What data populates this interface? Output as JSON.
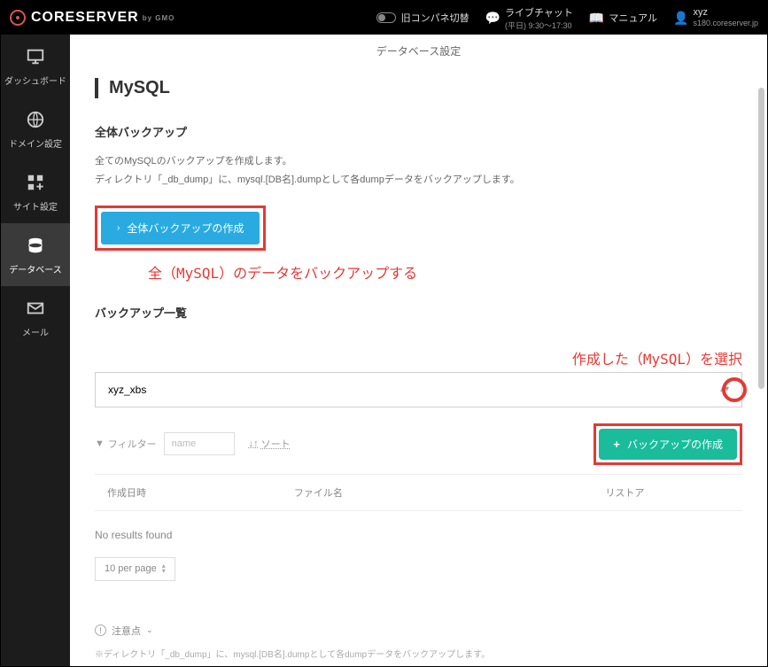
{
  "topbar": {
    "logo": "CORESERVER",
    "logo_sub": "by GMO",
    "old_panel": "旧コンパネ切替",
    "chat_label": "ライブチャット",
    "chat_hours": "(平日) 9:30～17:30",
    "manual": "マニュアル",
    "user": "xyz",
    "server": "s180.coreserver.jp"
  },
  "sidebar": {
    "items": [
      {
        "label": "ダッシュボード"
      },
      {
        "label": "ドメイン設定"
      },
      {
        "label": "サイト設定"
      },
      {
        "label": "データベース"
      },
      {
        "label": "メール"
      }
    ]
  },
  "crumb": "データベース設定",
  "page_title": "MySQL",
  "full_backup": {
    "heading": "全体バックアップ",
    "desc1": "全てのMySQLのバックアップを作成します。",
    "desc2": "ディレクトリ「_db_dump」に、mysql.[DB名].dumpとして各dumpデータをバックアップします。",
    "button": "全体バックアップの作成"
  },
  "annotations": {
    "a1": "全（MySQL）のデータをバックアップする",
    "a2": "作成した（MySQL）を選択"
  },
  "list": {
    "heading": "バックアップ一覧",
    "selected_db": "xyz_xbs",
    "filter_label": "フィルター",
    "filter_placeholder": "name",
    "sort_label": "ソート",
    "create_button": "バックアップの作成",
    "col1": "作成日時",
    "col2": "ファイル名",
    "col3": "リストア",
    "no_results": "No results found",
    "per_page": "10 per page"
  },
  "notes": {
    "heading": "注意点",
    "text": "※ディレクトリ「_db_dump」に、mysql.[DB名].dumpとして各dumpデータをバックアップします。"
  }
}
